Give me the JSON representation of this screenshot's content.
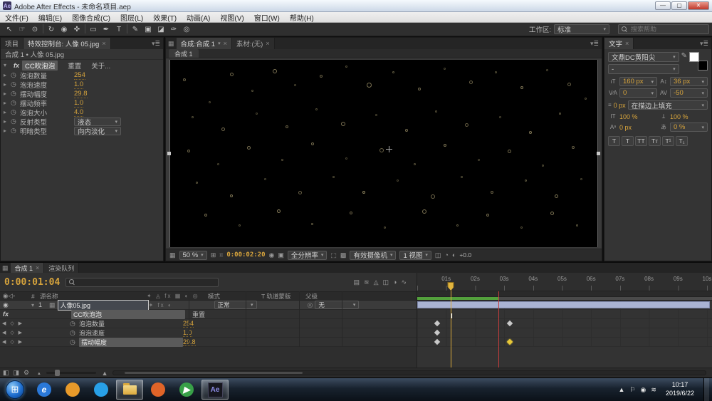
{
  "window": {
    "title": "Adobe After Effects - 未命名项目.aep",
    "app_badge": "Ae"
  },
  "menubar": {
    "items": [
      "文件(F)",
      "编辑(E)",
      "图像合成(C)",
      "图层(L)",
      "效果(T)",
      "动画(A)",
      "视图(V)",
      "窗口(W)",
      "帮助(H)"
    ]
  },
  "toolbar": {
    "tools": [
      {
        "name": "selection-tool",
        "glyph": "↖"
      },
      {
        "name": "hand-tool",
        "glyph": "☞"
      },
      {
        "name": "zoom-tool",
        "glyph": "⊙"
      },
      {
        "name": "rotation-tool",
        "glyph": "↻"
      },
      {
        "name": "unified-camera-tool",
        "glyph": "◉"
      },
      {
        "name": "pan-behind-tool",
        "glyph": "✜"
      },
      {
        "name": "mask-shape-tool",
        "glyph": "▭"
      },
      {
        "name": "pen-tool",
        "glyph": "✒"
      },
      {
        "name": "type-tool",
        "glyph": "T"
      },
      {
        "name": "brush-tool",
        "glyph": "✎"
      },
      {
        "name": "clone-stamp-tool",
        "glyph": "▣"
      },
      {
        "name": "eraser-tool",
        "glyph": "◪"
      },
      {
        "name": "roto-brush-tool",
        "glyph": "✑"
      },
      {
        "name": "puppet-pin-tool",
        "glyph": "◎"
      }
    ],
    "workspace_label": "工作区:",
    "workspace_value": "标准",
    "search_placeholder": "搜索帮助"
  },
  "effect_controls": {
    "tab_project": "项目",
    "tab_effects": "特效控制台: 人像 05.jpg",
    "context": "合成 1 • 人像 05.jpg",
    "effect_name": "CC吹泡泡",
    "reset_label": "重置",
    "about_label": "关于...",
    "properties": [
      {
        "label": "泡泡数量",
        "value": "254",
        "type": "value"
      },
      {
        "label": "泡泡速度",
        "value": "1.0",
        "type": "value"
      },
      {
        "label": "摆动幅度",
        "value": "29.8",
        "type": "value"
      },
      {
        "label": "摆动频率",
        "value": "1.0",
        "type": "value"
      },
      {
        "label": "泡泡大小",
        "value": "4.0",
        "type": "value"
      },
      {
        "label": "反射类型",
        "value": "液态",
        "type": "dropdown"
      },
      {
        "label": "明暗类型",
        "value": "向内淡化",
        "type": "dropdown"
      }
    ]
  },
  "viewer": {
    "tab_comp": "合成:合成 1",
    "tab_footage": "素材:(无)",
    "comp_label": "合成 1",
    "zoom": "50 %",
    "timecode": "0:00:02:20",
    "resolution": "全分辨率",
    "camera": "有效摄像机",
    "view_count": "1 视图",
    "exposure": "+0.0",
    "bubbles": [
      [
        3,
        10,
        4,
        0.5
      ],
      [
        9,
        22,
        3,
        0.35
      ],
      [
        14,
        7,
        5,
        0.55
      ],
      [
        19,
        16,
        3,
        0.4
      ],
      [
        24,
        5,
        6,
        0.6
      ],
      [
        29,
        13,
        3,
        0.35
      ],
      [
        35,
        8,
        4,
        0.5
      ],
      [
        41,
        3,
        3,
        0.4
      ],
      [
        46,
        12,
        7,
        0.6
      ],
      [
        52,
        6,
        3,
        0.45
      ],
      [
        58,
        15,
        4,
        0.55
      ],
      [
        64,
        4,
        3,
        0.35
      ],
      [
        70,
        11,
        5,
        0.5
      ],
      [
        76,
        6,
        3,
        0.4
      ],
      [
        82,
        14,
        4,
        0.6
      ],
      [
        88,
        5,
        3,
        0.35
      ],
      [
        93,
        12,
        5,
        0.5
      ],
      [
        97,
        20,
        3,
        0.4
      ],
      [
        5,
        30,
        3,
        0.4
      ],
      [
        12,
        36,
        5,
        0.55
      ],
      [
        20,
        28,
        3,
        0.35
      ],
      [
        27,
        35,
        4,
        0.5
      ],
      [
        34,
        26,
        3,
        0.4
      ],
      [
        40,
        33,
        6,
        0.6
      ],
      [
        48,
        29,
        3,
        0.35
      ],
      [
        55,
        37,
        4,
        0.55
      ],
      [
        62,
        27,
        3,
        0.4
      ],
      [
        69,
        34,
        5,
        0.5
      ],
      [
        77,
        30,
        3,
        0.35
      ],
      [
        84,
        38,
        4,
        0.6
      ],
      [
        91,
        28,
        3,
        0.45
      ],
      [
        4,
        48,
        4,
        0.5
      ],
      [
        11,
        55,
        3,
        0.35
      ],
      [
        18,
        46,
        5,
        0.6
      ],
      [
        26,
        53,
        3,
        0.4
      ],
      [
        33,
        44,
        4,
        0.55
      ],
      [
        41,
        52,
        3,
        0.35
      ],
      [
        49,
        47,
        6,
        0.5
      ],
      [
        57,
        55,
        3,
        0.4
      ],
      [
        64,
        45,
        4,
        0.6
      ],
      [
        72,
        53,
        3,
        0.35
      ],
      [
        79,
        48,
        5,
        0.55
      ],
      [
        87,
        56,
        3,
        0.4
      ],
      [
        94,
        46,
        4,
        0.5
      ],
      [
        6,
        65,
        3,
        0.45
      ],
      [
        14,
        72,
        4,
        0.6
      ],
      [
        22,
        63,
        3,
        0.35
      ],
      [
        30,
        70,
        5,
        0.5
      ],
      [
        38,
        62,
        3,
        0.4
      ],
      [
        45,
        70,
        4,
        0.65
      ],
      [
        53,
        64,
        3,
        0.35
      ],
      [
        61,
        72,
        6,
        0.55
      ],
      [
        68,
        62,
        3,
        0.4
      ],
      [
        75,
        70,
        4,
        0.5
      ],
      [
        83,
        64,
        3,
        0.45
      ],
      [
        90,
        72,
        5,
        0.6
      ],
      [
        96,
        63,
        3,
        0.35
      ],
      [
        8,
        82,
        4,
        0.55
      ],
      [
        16,
        88,
        3,
        0.4
      ],
      [
        25,
        80,
        5,
        0.65
      ],
      [
        33,
        87,
        3,
        0.45
      ],
      [
        42,
        81,
        4,
        0.5
      ],
      [
        50,
        89,
        3,
        0.4
      ],
      [
        59,
        80,
        6,
        0.6
      ],
      [
        67,
        88,
        3,
        0.45
      ],
      [
        74,
        82,
        4,
        0.55
      ],
      [
        82,
        89,
        3,
        0.4
      ],
      [
        89,
        81,
        5,
        0.6
      ],
      [
        95,
        88,
        3,
        0.45
      ]
    ]
  },
  "character": {
    "tab": "文字",
    "font_family": "文鼎DC黄阳尖",
    "font_style": "-",
    "font_size": "160 px",
    "leading": "36 px",
    "kerning": "0",
    "tracking": "-50",
    "stroke_width": "0 px",
    "stroke_option": "在描边上填充",
    "vertical_scale": "100 %",
    "horizontal_scale": "100 %",
    "baseline_shift": "0 px",
    "tsume": "0 %",
    "style_buttons": [
      "T",
      "T",
      "TT",
      "Tт",
      "T¹",
      "T₁"
    ]
  },
  "timeline": {
    "tab_comp": "合成 1",
    "tab_queue": "渲染队列",
    "timecode": "0:00:01:04",
    "header": {
      "hash": "#",
      "source_name": "源名称",
      "switches": "✦ ◬ fx ▦ ◐ ◎",
      "mode": "模式",
      "trkmat": "T 轨道蒙版",
      "parent": "父级"
    },
    "layer": {
      "number": "1",
      "name": "人像05.jpg",
      "mode": "正常",
      "parent": "无"
    },
    "rows": [
      {
        "kind": "group",
        "label": "CC吹泡泡",
        "value": "重置",
        "selected": true,
        "keyframes": []
      },
      {
        "kind": "prop",
        "label": "泡泡数量",
        "value": "254",
        "keyframes": [
          {
            "t": 0.7
          },
          {
            "t": 3.2
          }
        ]
      },
      {
        "kind": "prop",
        "label": "泡泡速度",
        "value": "1.0",
        "keyframes": [
          {
            "t": 0.7
          }
        ]
      },
      {
        "kind": "prop",
        "label": "摆动幅度",
        "value": "29.8",
        "selected": true,
        "keyframes": [
          {
            "t": 0.7
          },
          {
            "t": 3.2,
            "active": true
          }
        ]
      }
    ],
    "ruler": {
      "labels": [
        "01s",
        "02s",
        "03s",
        "04s",
        "05s",
        "06s",
        "07s",
        "08s",
        "09s",
        "10s"
      ],
      "duration_s": 10
    },
    "playhead_s": 1.16,
    "marker_s": 2.8,
    "render_bar_end_s": 2.8
  },
  "taskbar": {
    "start_glyph": "⊞",
    "items": [
      {
        "name": "taskbar-ie-browser",
        "kind": "circle",
        "bg": "#2a78d8",
        "glyph": "e"
      },
      {
        "name": "taskbar-browser-orange",
        "kind": "circle",
        "bg": "#e89a2a",
        "glyph": ""
      },
      {
        "name": "taskbar-qq",
        "kind": "circle",
        "bg": "#28a0e8",
        "glyph": ""
      },
      {
        "name": "taskbar-explorer-folder",
        "kind": "folder",
        "active": true
      },
      {
        "name": "taskbar-firefox",
        "kind": "circle",
        "bg": "#e06428",
        "glyph": ""
      },
      {
        "name": "taskbar-media-player",
        "kind": "circle",
        "bg": "#38a048",
        "glyph": "▶"
      },
      {
        "name": "taskbar-after-effects",
        "kind": "ae",
        "glyph": "Ae",
        "active": true
      }
    ],
    "tray_icons": [
      "▲",
      "⚐",
      "◉",
      "≋"
    ],
    "clock_time": "10:17",
    "clock_date": "2019/6/22"
  },
  "icons": {
    "fx": "fx",
    "stopwatch": "◷",
    "kf_prev": "◀",
    "kf_diamond": "◇",
    "kf_next": "▶",
    "twirl_open": "▾",
    "twirl_closed": "▸",
    "eye": "◉"
  }
}
